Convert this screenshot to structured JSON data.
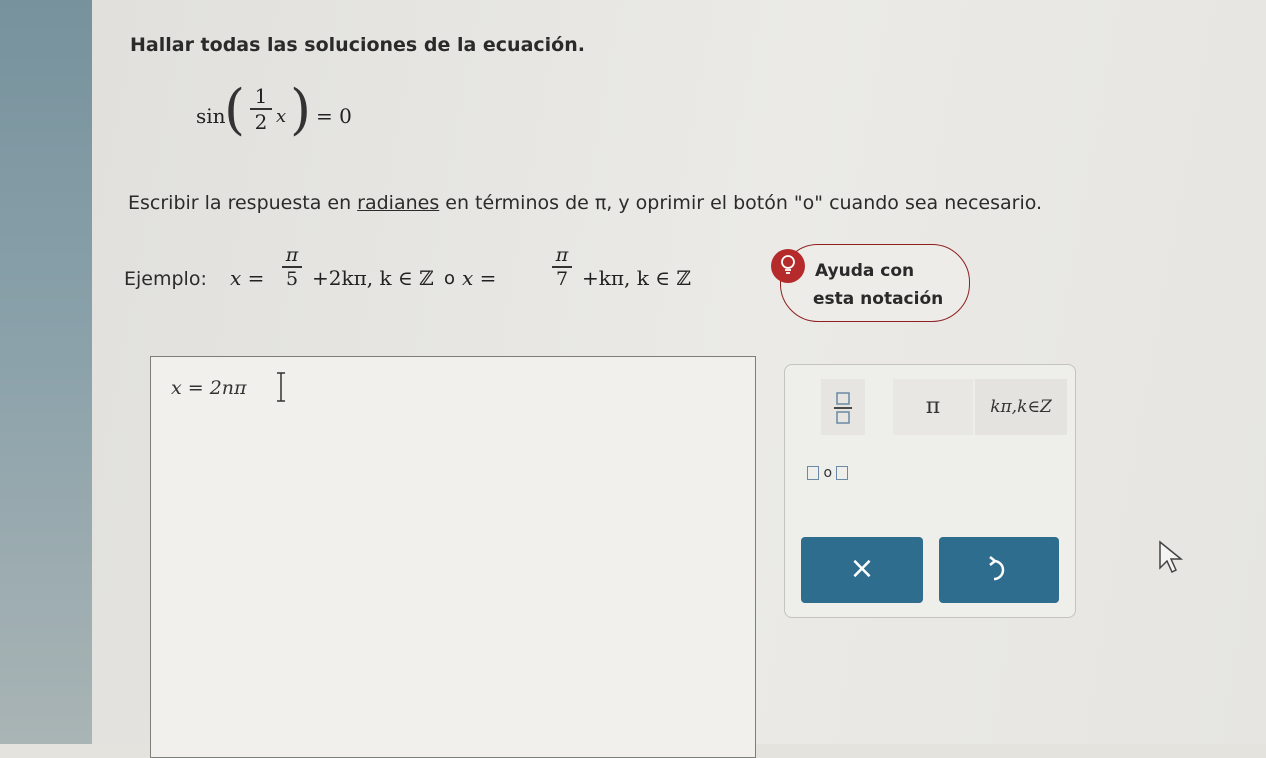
{
  "problem": {
    "title": "Hallar todas las soluciones de la ecuación.",
    "equation": {
      "func": "sin",
      "numerator": "1",
      "denominator": "2",
      "variable": "x",
      "rhs": "= 0"
    },
    "instruction_before": "Escribir la respuesta en ",
    "instruction_link": "radianes",
    "instruction_after": " en términos de π, y oprimir el botón \"o\" cuando sea necesario."
  },
  "example": {
    "label": "Ejemplo:",
    "part1_lhs": "x =",
    "frac1_num": "π",
    "frac1_den": "5",
    "part1_rhs": "+2kπ, k ∈ ℤ",
    "or": "o",
    "part2_lhs": "x =",
    "frac2_num": "π",
    "frac2_den": "7",
    "part2_rhs": "+kπ, k ∈ ℤ"
  },
  "help": {
    "line1": "Ayuda con",
    "line2": "esta notación",
    "icon": "lightbulb-icon"
  },
  "answer": {
    "value": "x = 2nπ"
  },
  "keypad": {
    "pi_key": "π",
    "kpi_key": "kπ,k∈Z",
    "or_key": "o",
    "clear_label": "×",
    "undo_icon": "undo-icon"
  },
  "colors": {
    "button_bg": "#2f6d8f",
    "help_accent": "#b52a2a",
    "sidebar": "#8aa1aa"
  }
}
